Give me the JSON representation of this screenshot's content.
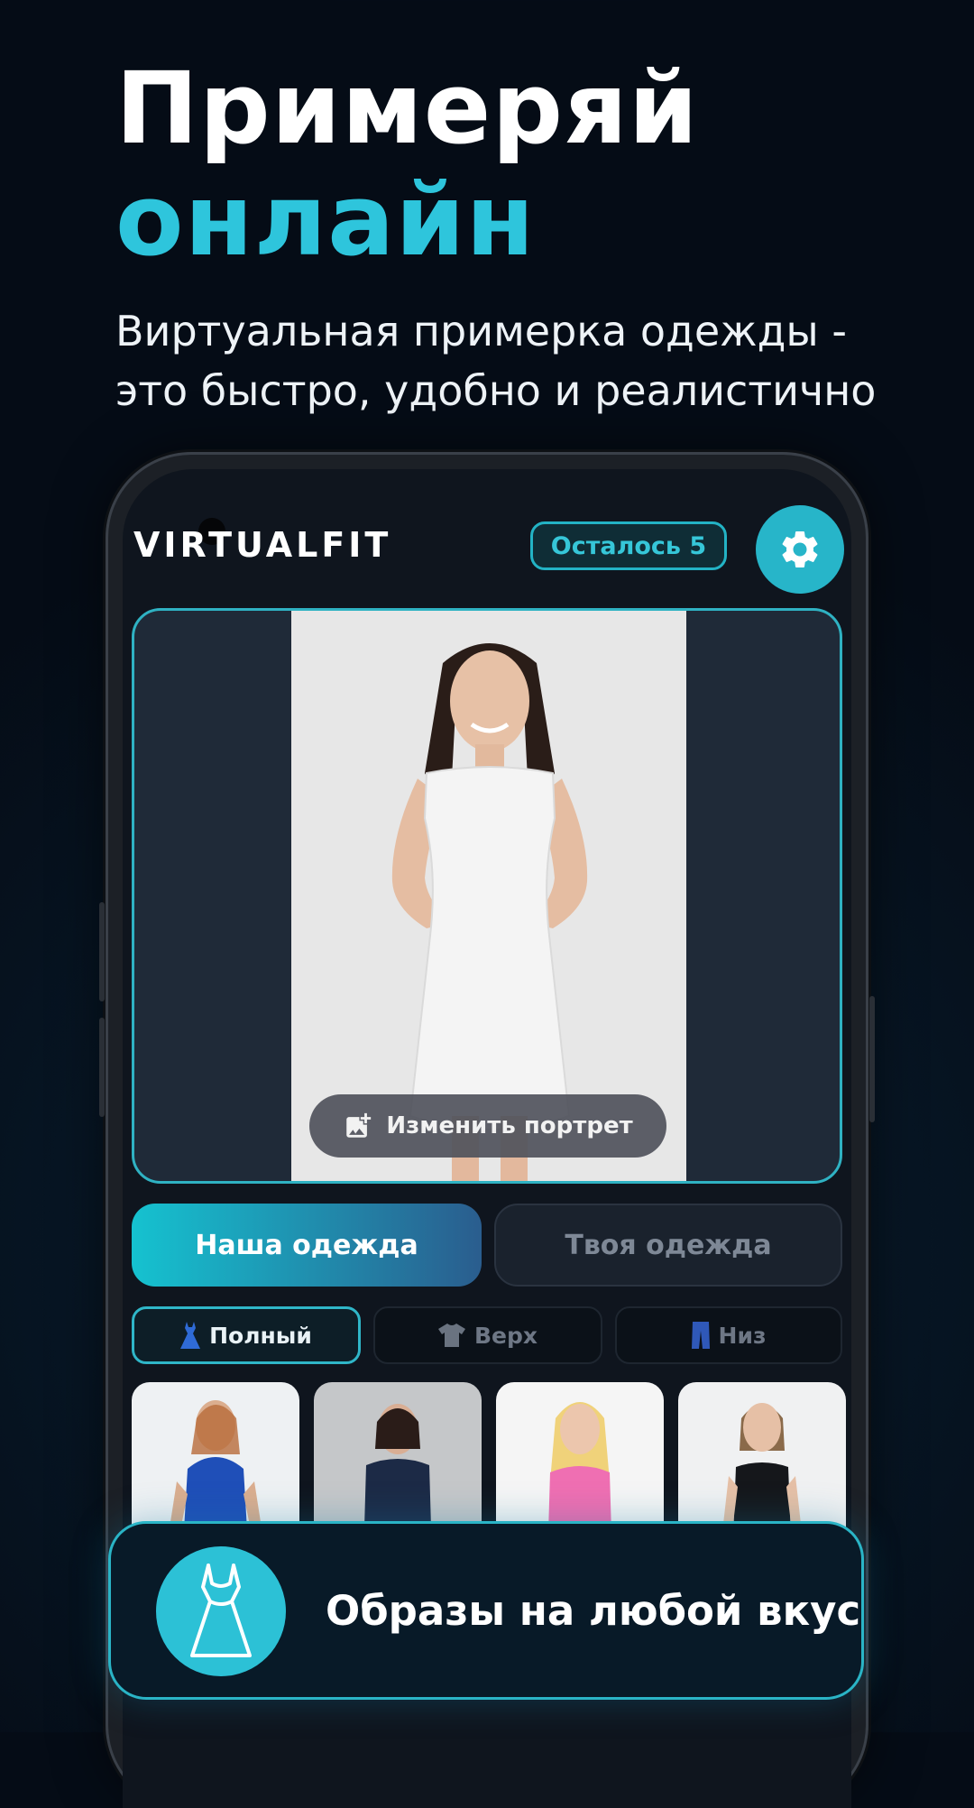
{
  "promo": {
    "title_line1": "Примеряй",
    "title_line2": "онлайн",
    "subtitle": "Виртуальная примерка одежды - это быстро, удобно и реалистично"
  },
  "app": {
    "logo": "VIRTUALFIT",
    "remaining_badge": "Осталось 5",
    "settings_icon": "gear-icon",
    "change_portrait_label": "Изменить портрет",
    "tabs": [
      {
        "label": "Наша одежда",
        "active": true
      },
      {
        "label": "Твоя одежда",
        "active": false
      }
    ],
    "categories": [
      {
        "label": "Полный",
        "icon": "dress-icon",
        "active": true
      },
      {
        "label": "Верх",
        "icon": "tshirt-icon",
        "active": false
      },
      {
        "label": "Низ",
        "icon": "pants-icon",
        "active": false
      }
    ]
  },
  "banner": {
    "text": "Образы на любой вкус",
    "icon": "dress-icon"
  },
  "colors": {
    "accent": "#2ec5dc",
    "background": "#071726",
    "dress_colors": [
      "#1f4fb8",
      "#1c2a46",
      "#ef6fb2",
      "#15171b"
    ]
  }
}
